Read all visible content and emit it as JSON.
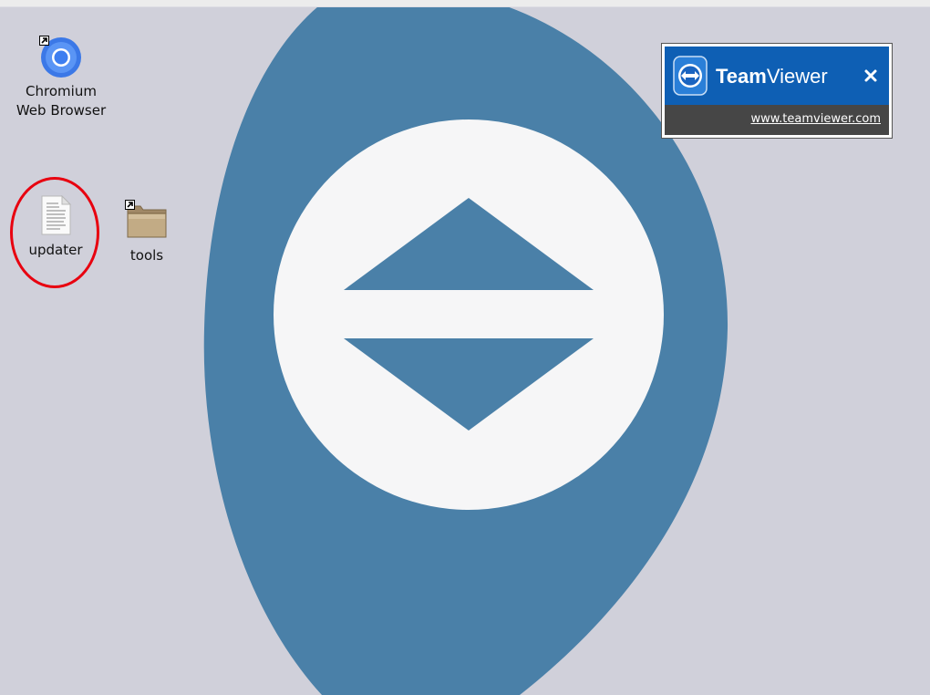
{
  "desktop": {
    "wallpaper_colors": {
      "background": "#d0d0da",
      "shape": "#4a80a8",
      "circle": "#f6f6f7"
    },
    "icons": [
      {
        "id": "chromium",
        "label_line1": "Chromium",
        "label_line2": "Web Browser",
        "icon": "chromium-icon",
        "shortcut": true
      },
      {
        "id": "updater",
        "label": "updater",
        "icon": "text-file-icon",
        "shortcut": false,
        "highlighted": true
      },
      {
        "id": "tools",
        "label": "tools",
        "icon": "folder-icon",
        "shortcut": true
      }
    ],
    "highlight_color": "#e8000f"
  },
  "teamviewer_popup": {
    "brand_bold": "Team",
    "brand_regular": "Viewer",
    "close_icon": "close-icon",
    "link_text": "www.teamviewer.com",
    "header_color": "#0e5fb4",
    "footer_color": "#464646"
  }
}
